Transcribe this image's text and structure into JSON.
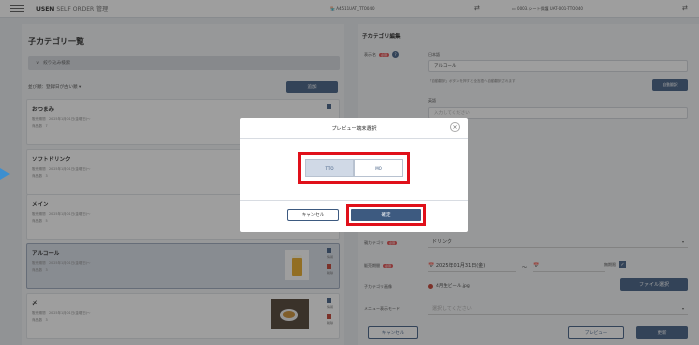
{
  "header": {
    "brand_bold": "USEN",
    "brand_rest": "SELF ORDER 管理",
    "store": "🏪 A4511UAT_TTO040",
    "terminal": "▭ 0003.シート保護 UAT-001-TTO040"
  },
  "left_panel": {
    "title": "子カテゴリ一覧",
    "filter_label": "絞り込み検索",
    "sort_label": "並び順：登録日が古い順",
    "add_button": "追加",
    "cards": [
      {
        "name": "おつまみ",
        "period": "販売期間　2025年1月01日(金曜日)～",
        "item_count": "商品数　7"
      },
      {
        "name": "ソフトドリンク",
        "period": "販売期間　2025年1月01日(金曜日)～",
        "item_count": "商品数　3"
      },
      {
        "name": "メイン",
        "period": "販売期間　2025年1月01日(金曜日)～",
        "item_count": "商品数　5"
      },
      {
        "name": "アルコール",
        "period": "販売期間　2025年1月01日(金曜日)～",
        "item_count": "商品数　3"
      },
      {
        "name": "〆",
        "period": "販売期間　2025年1月01日(金曜日)～",
        "item_count": "商品数　3"
      }
    ],
    "icon_label_info": "情報",
    "icon_label_delete": "削除"
  },
  "right_panel": {
    "title": "子カテゴリ編集",
    "display_name_label": "表示名",
    "required": "必須",
    "lang_ja": "日本語",
    "value_ja": "アルコール",
    "hint": "「自動翻訳」ボタンを押すと全言語へ自動翻訳されます",
    "auto_translate": "自動翻訳",
    "lang_en": "英語",
    "placeholder_en": "入力してください",
    "parent_label": "親カテゴリ",
    "parent_value": "ドリンク",
    "period_label": "販売期間",
    "period_start": "📅 2025年01月31日(金)",
    "period_unlimited": "無期限",
    "image_label": "子カテゴリ画像",
    "image_name": "4月生ビール.jpg",
    "file_select": "ファイル選択",
    "menu_mode_label": "メニュー表示モード",
    "menu_mode_placeholder": "選択してください",
    "cancel": "キャンセル",
    "preview": "プレビュー",
    "update": "更新"
  },
  "modal": {
    "title": "プレビュー端末選択",
    "close": "×",
    "option_tto": "TTO",
    "option_mo": "MO",
    "cancel": "キャンセル",
    "confirm": "確定"
  }
}
